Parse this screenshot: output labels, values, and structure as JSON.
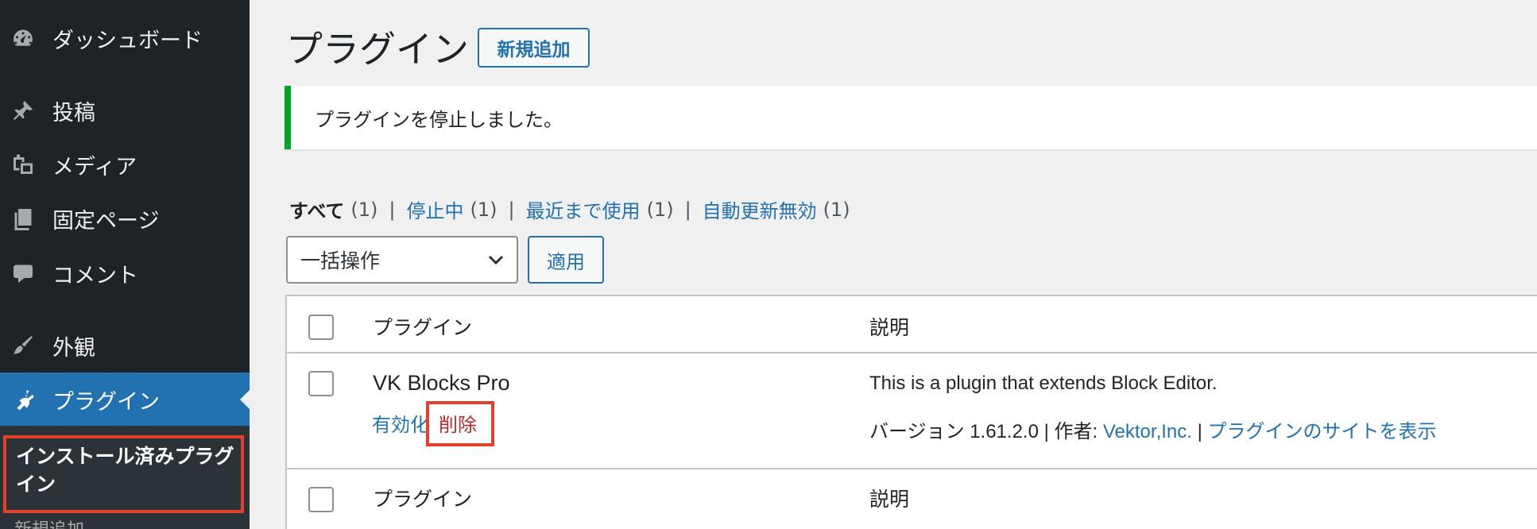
{
  "sidebar": {
    "items": [
      {
        "label": "ダッシュボード",
        "icon": "dashboard-icon"
      },
      {
        "label": "投稿",
        "icon": "pushpin-icon"
      },
      {
        "label": "メディア",
        "icon": "media-icon"
      },
      {
        "label": "固定ページ",
        "icon": "pages-icon"
      },
      {
        "label": "コメント",
        "icon": "comment-icon"
      },
      {
        "label": "外観",
        "icon": "appearance-brush-icon"
      },
      {
        "label": "プラグイン",
        "icon": "plugin-icon"
      }
    ],
    "submenu": {
      "current": "インストール済みプラグイン",
      "next": "新規追加"
    }
  },
  "page": {
    "title": "プラグイン",
    "add_new": "新規追加"
  },
  "notice": {
    "text": "プラグインを停止しました。",
    "color": "#00a32a"
  },
  "views": {
    "all": "すべて",
    "all_count": "(1)",
    "inactive": "停止中",
    "inactive_count": "(1)",
    "recent": "最近まで使用",
    "recent_count": "(1)",
    "autoupdate_disabled": "自動更新無効",
    "autoupdate_disabled_count": "(1)",
    "separator": "|"
  },
  "bulk": {
    "selected": "一括操作",
    "apply": "適用"
  },
  "table": {
    "columns": {
      "plugin": "プラグイン",
      "description": "説明"
    },
    "rows": [
      {
        "name": "VK Blocks Pro",
        "actions": {
          "activate": "有効化",
          "delete": "削除"
        },
        "description": "This is a plugin that extends Block Editor.",
        "version_label": "バージョン 1.61.2.0",
        "sep1": "|",
        "author_label": "作者:",
        "author": "Vektor,Inc.",
        "sep2": "|",
        "site_link": "プラグインのサイトを表示"
      }
    ]
  },
  "colors": {
    "sidebar_bg": "#1d2327",
    "accent": "#2271b1",
    "delete": "#b32d2e",
    "highlight_box": "#e2412e"
  }
}
